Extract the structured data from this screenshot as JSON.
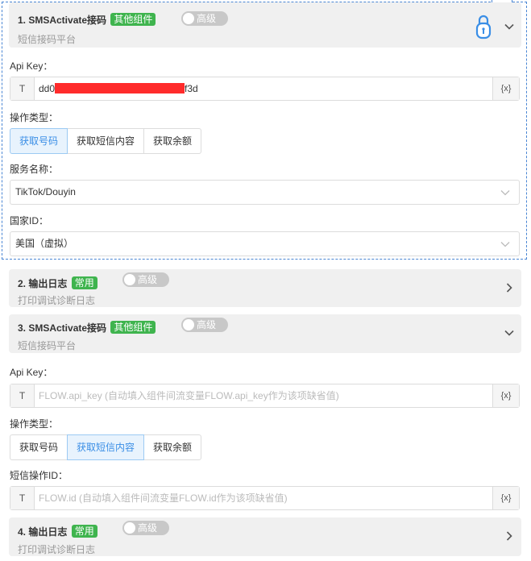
{
  "blocks": {
    "b1": {
      "title": "1. SMSActivate接码",
      "tag": "其他组件",
      "subtitle": "短信接码平台",
      "toggle_label": "高级",
      "api_key_label": "Api Key：",
      "api_key_prefix": "T",
      "api_key_start": "dd0",
      "api_key_end": "f3d",
      "var_button": "{x}",
      "op_label": "操作类型：",
      "ops": [
        "获取号码",
        "获取短信内容",
        "获取余额"
      ],
      "service_label": "服务名称：",
      "service_value": "TikTok/Douyin",
      "country_label": "国家ID：",
      "country_value": "美国（虚拟）"
    },
    "b2": {
      "title": "2. 输出日志",
      "tag": "常用",
      "subtitle": "打印调试诊断日志",
      "toggle_label": "高级"
    },
    "b3": {
      "title": "3. SMSActivate接码",
      "tag": "其他组件",
      "subtitle": "短信接码平台",
      "toggle_label": "高级",
      "api_key_label": "Api Key：",
      "api_key_prefix": "T",
      "api_key_placeholder": "FLOW.api_key (自动填入组件间流变量FLOW.api_key作为该项缺省值)",
      "var_button": "{x}",
      "op_label": "操作类型：",
      "ops": [
        "获取号码",
        "获取短信内容",
        "获取余额"
      ],
      "sms_id_label": "短信操作ID：",
      "sms_id_prefix": "T",
      "sms_id_placeholder": "FLOW.id (自动填入组件间流变量FLOW.id作为该项缺省值)",
      "sms_var_button": "{x}"
    },
    "b4": {
      "title": "4. 输出日志",
      "tag": "常用",
      "subtitle": "打印调试诊断日志",
      "toggle_label": "高级"
    }
  },
  "colors": {
    "tag_green": "#3fb44e",
    "accent_blue": "#3a8ee6",
    "selection_dashed": "#4a86d4",
    "redaction": "#ff2b2b"
  }
}
